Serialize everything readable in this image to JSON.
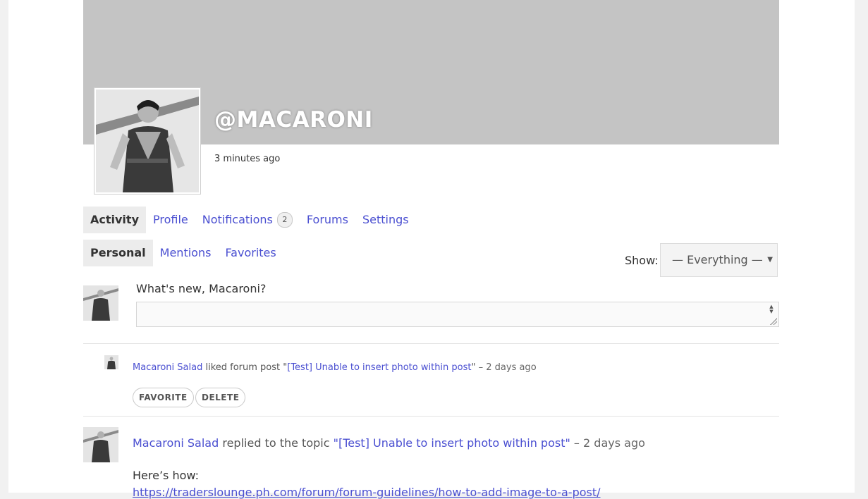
{
  "profile": {
    "username": "@MACARONI",
    "last_active": "3 minutes ago"
  },
  "nav_main": [
    {
      "label": "Activity",
      "active": true
    },
    {
      "label": "Profile"
    },
    {
      "label": "Notifications",
      "badge": "2"
    },
    {
      "label": "Forums"
    },
    {
      "label": "Settings"
    }
  ],
  "nav_sub": [
    {
      "label": "Personal",
      "active": true
    },
    {
      "label": "Mentions"
    },
    {
      "label": "Favorites"
    }
  ],
  "filter": {
    "label": "Show:",
    "selected": "— Everything —",
    "caret": "▼"
  },
  "post_form": {
    "label": "What's new, Macaroni?",
    "spinner_up": "▲",
    "spinner_down": "▼"
  },
  "activity_1": {
    "user": "Macaroni Salad",
    "action": " liked forum post \"",
    "target": "[Test] Unable to insert photo within post",
    "quote_close": "\"",
    "time": " – 2 days ago",
    "favorite_label": "FAVORITE",
    "delete_label": "DELETE"
  },
  "activity_2": {
    "user": "Macaroni Salad",
    "action": " replied to the topic ",
    "target": "\"[Test] Unable to insert photo within post\"",
    "time": " – 2 days ago",
    "body": "Here’s how:",
    "link": "https://traderslounge.ph.com/forum/forum-guidelines/how-to-add-image-to-a-post/"
  },
  "colors": {
    "link": "#4a4fd1",
    "cover": "#c4c4c4"
  }
}
